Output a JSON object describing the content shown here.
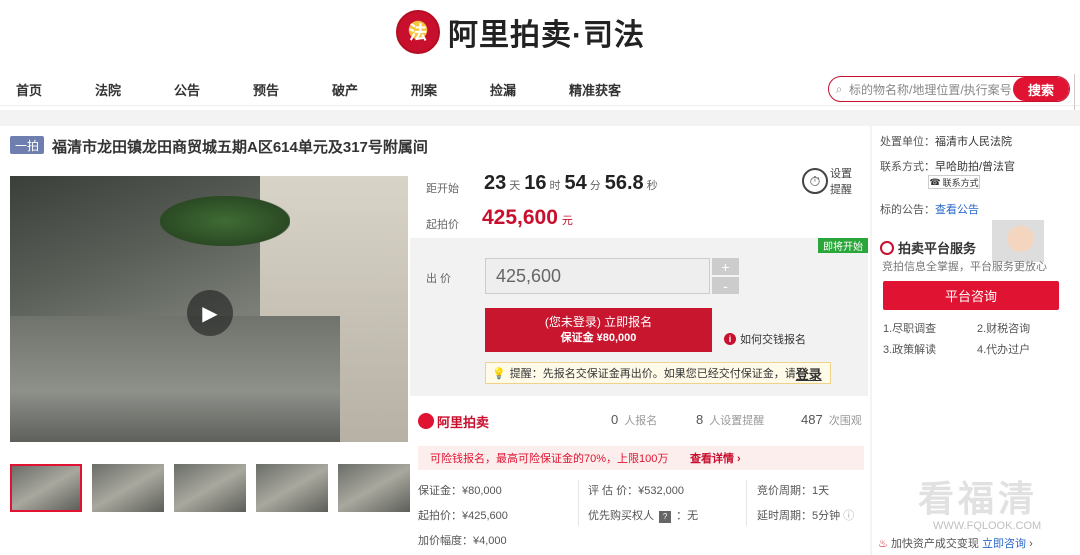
{
  "header": {
    "logo_text": "阿里拍卖·司法",
    "emblem": "court-emblem-icon"
  },
  "nav": {
    "items": [
      "首页",
      "法院",
      "公告",
      "预告",
      "破产",
      "刑案",
      "捡漏",
      "精准获客"
    ]
  },
  "search": {
    "placeholder": "标的物名称/地理位置/执行案号",
    "button": "搜索"
  },
  "listing": {
    "tag": "一拍",
    "title": "福清市龙田镇龙田商贸城五期A区614单元及317号附属间",
    "countdown_label": "距开始",
    "countdown": {
      "days": "23",
      "day_unit": "天",
      "hours": "16",
      "hour_unit": "时",
      "minutes": "54",
      "minute_unit": "分",
      "seconds": "56.8",
      "second_unit": "秒"
    },
    "reminder_label": "设置提醒",
    "start_price_label": "起拍价",
    "start_price": "425,600",
    "currency_unit": "元",
    "status_badge": "即将开始",
    "bid_label": "出 价",
    "bid_value": "425,600",
    "plus": "+",
    "minus": "-",
    "signup_line1": "(您未登录) 立即报名",
    "signup_line2": "保证金 ¥80,000",
    "howpay": "如何交钱报名",
    "tip_text": "提醒：先报名交保证金再出价。如果您已经交付保证金，请",
    "tip_login": "登录"
  },
  "stats": {
    "brand": "阿里拍卖",
    "signup_count": "0",
    "signup_label": "人报名",
    "remind_count": "8",
    "remind_label": "人设置提醒",
    "view_count": "487",
    "view_label": "次围观"
  },
  "promo": {
    "text": "可险钱报名，最高可险保证金的70%，上限100万",
    "link": "查看详情 ›"
  },
  "details": {
    "deposit": "保证金：¥80,000",
    "appraisal": "评 估 价：¥532,000",
    "period": "竞价周期：1天",
    "start": "起拍价：¥425,600",
    "priority": "优先购买权人",
    "priority_val": "：无",
    "delay": "延时周期：5分钟",
    "increment": "加价幅度：¥4,000"
  },
  "right": {
    "unit_label": "处置单位：",
    "unit_value": "福清市人民法院",
    "contact_label": "联系方式：",
    "contact_value": "早哈助拍/曾法官",
    "contact_btn": "联系方式",
    "notice_label": "标的公告：",
    "notice_link": "查看公告",
    "service_title": "拍卖平台服务",
    "service_sub": "竞拍信息全掌握，平台服务更放心",
    "consult": "平台咨询",
    "services": [
      "1.尽职调查",
      "2.财税咨询",
      "3.政策解读",
      "4.代办过户"
    ],
    "bottom_text": "加快资产成交变现",
    "bottom_link": "立即咨询"
  },
  "watermark": {
    "text": "看福清",
    "url": "WWW.FQLOOK.COM"
  }
}
